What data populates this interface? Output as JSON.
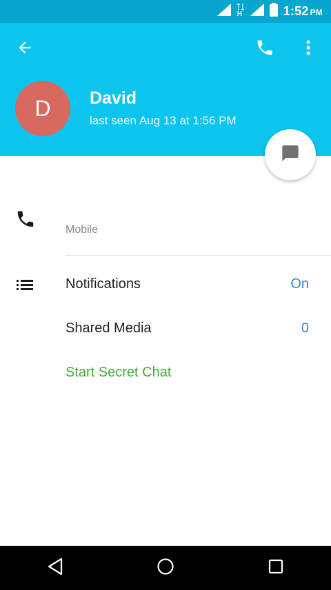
{
  "status_bar": {
    "time": "1:52",
    "ampm": "PM",
    "network_type": "H",
    "icons": [
      "signal-icon",
      "signal-icon",
      "battery-icon"
    ]
  },
  "header": {
    "back_icon": "arrow-left-icon",
    "call_icon": "phone-icon",
    "more_icon": "more-vertical-icon",
    "avatar_letter": "D",
    "name": "David",
    "last_seen": "last seen Aug 13 at 1:56 PM",
    "fab_icon": "message-icon",
    "colors": {
      "header": "#0cc4ee",
      "status": "#06a6cf",
      "avatar": "#d9685f"
    }
  },
  "contact": {
    "phone_icon": "phone-icon",
    "phone_label": "Mobile"
  },
  "settings": [
    {
      "label": "Notifications",
      "value": "On"
    },
    {
      "label": "Shared Media",
      "value": "0"
    }
  ],
  "secret_chat_label": "Start Secret Chat",
  "nav": {
    "back_icon": "nav-back-icon",
    "home_icon": "nav-home-icon",
    "recents_icon": "nav-recents-icon"
  }
}
